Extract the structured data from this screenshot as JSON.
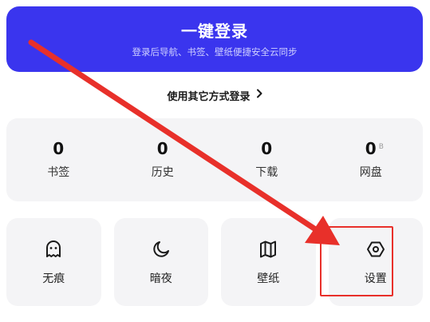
{
  "login": {
    "title": "一键登录",
    "subtitle": "登录后导航、书签、壁纸便捷安全云同步"
  },
  "other_login": {
    "label": "使用其它方式登录",
    "icon": "chevron-right-icon"
  },
  "stats": [
    {
      "value": "0",
      "label": "书签"
    },
    {
      "value": "0",
      "label": "历史"
    },
    {
      "value": "0",
      "label": "下载"
    },
    {
      "value": "0",
      "unit": "B",
      "label": "网盘"
    }
  ],
  "tools": [
    {
      "label": "无痕",
      "icon": "ghost-icon"
    },
    {
      "label": "暗夜",
      "icon": "moon-icon"
    },
    {
      "label": "壁纸",
      "icon": "map-wallpaper-icon"
    },
    {
      "label": "设置",
      "icon": "hexagon-settings-icon"
    }
  ],
  "colors": {
    "accent": "#3a35ee",
    "annotation": "#e8302a",
    "card_bg": "#f4f4f6"
  }
}
